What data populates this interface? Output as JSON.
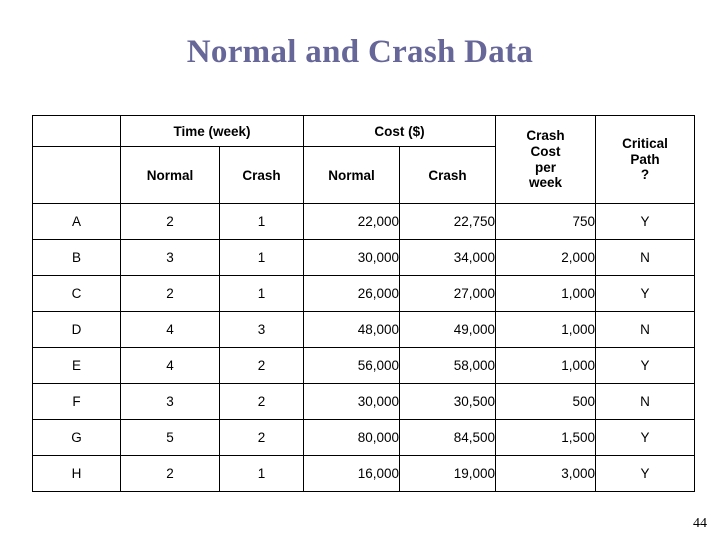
{
  "slide": {
    "title": "Normal and Crash Data",
    "page_number": "44"
  },
  "table": {
    "group_headers": {
      "blank_corner": "",
      "time": "Time (week)",
      "cost": "Cost ($)",
      "crash_cost_per_week": "Crash\nCost\nper\nweek",
      "critical_path": "Critical\nPath\n?"
    },
    "crash_cost_lines": [
      "Crash",
      "Cost",
      "per",
      "week"
    ],
    "critical_path_lines": [
      "Critical",
      "Path",
      "?"
    ],
    "sub_headers": {
      "time_normal": "Normal",
      "time_crash": "Crash",
      "cost_normal": "Normal",
      "cost_crash": "Crash"
    },
    "rows": [
      {
        "activity": "A",
        "time_normal": "2",
        "time_crash": "1",
        "cost_normal": "22,000",
        "cost_crash": "22,750",
        "crash_cost_week": "750",
        "critical": "Y"
      },
      {
        "activity": "B",
        "time_normal": "3",
        "time_crash": "1",
        "cost_normal": "30,000",
        "cost_crash": "34,000",
        "crash_cost_week": "2,000",
        "critical": "N"
      },
      {
        "activity": "C",
        "time_normal": "2",
        "time_crash": "1",
        "cost_normal": "26,000",
        "cost_crash": "27,000",
        "crash_cost_week": "1,000",
        "critical": "Y"
      },
      {
        "activity": "D",
        "time_normal": "4",
        "time_crash": "3",
        "cost_normal": "48,000",
        "cost_crash": "49,000",
        "crash_cost_week": "1,000",
        "critical": "N"
      },
      {
        "activity": "E",
        "time_normal": "4",
        "time_crash": "2",
        "cost_normal": "56,000",
        "cost_crash": "58,000",
        "crash_cost_week": "1,000",
        "critical": "Y"
      },
      {
        "activity": "F",
        "time_normal": "3",
        "time_crash": "2",
        "cost_normal": "30,000",
        "cost_crash": "30,500",
        "crash_cost_week": "500",
        "critical": "N"
      },
      {
        "activity": "G",
        "time_normal": "5",
        "time_crash": "2",
        "cost_normal": "80,000",
        "cost_crash": "84,500",
        "crash_cost_week": "1,500",
        "critical": "Y"
      },
      {
        "activity": "H",
        "time_normal": "2",
        "time_crash": "1",
        "cost_normal": "16,000",
        "cost_crash": "19,000",
        "crash_cost_week": "3,000",
        "critical": "Y"
      }
    ]
  },
  "colors": {
    "title": "#666699",
    "text": "#000000",
    "border": "#000000",
    "background": "#ffffff"
  }
}
